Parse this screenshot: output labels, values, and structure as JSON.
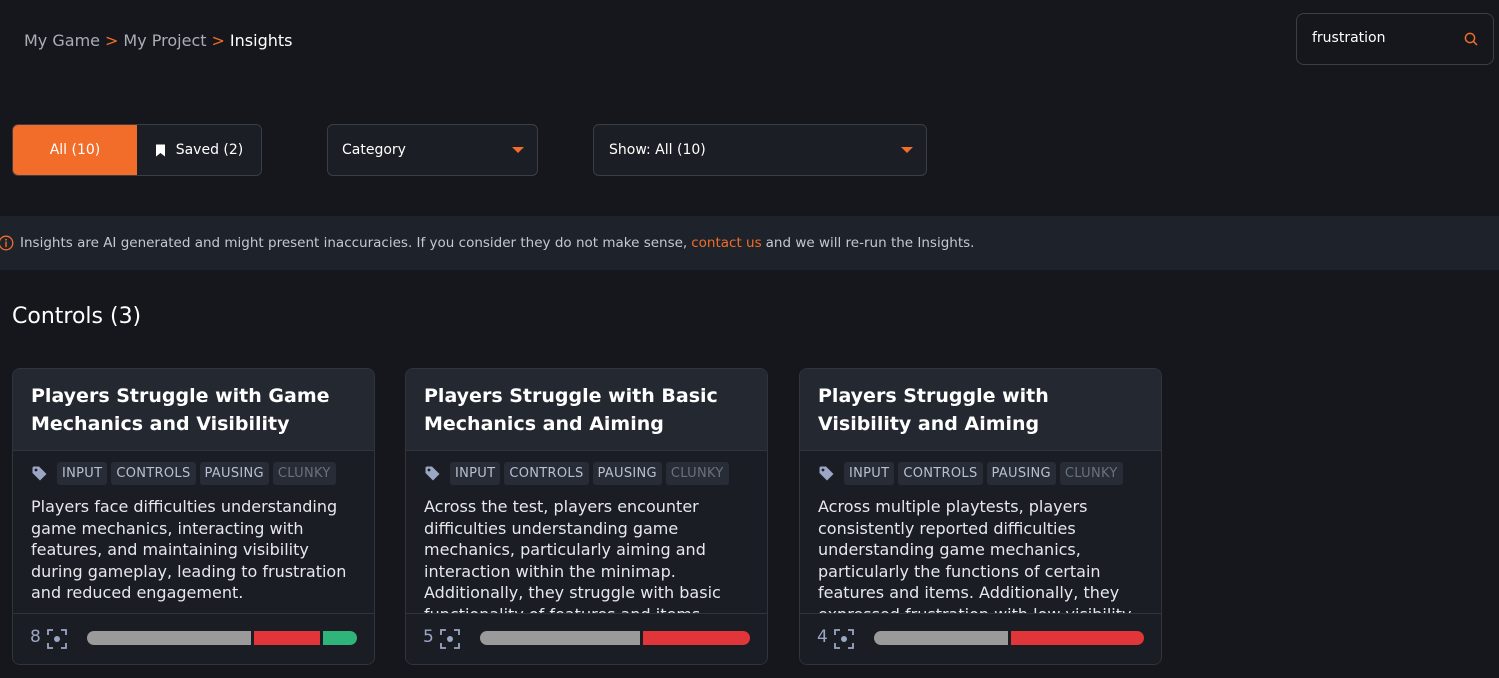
{
  "breadcrumb": {
    "items": [
      "My Game",
      "My Project"
    ],
    "current": "Insights",
    "separator": ">"
  },
  "search": {
    "value": "frustration",
    "placeholder": ""
  },
  "tabs": {
    "all_label": "All (10)",
    "saved_label": "Saved (2)"
  },
  "filters": {
    "category_label": "Category",
    "show_label": "Show: All (10)"
  },
  "notice": {
    "text_before": "Insights are AI generated and might present inaccuracies. If you consider they do not make sense,",
    "link_text": "contact us",
    "text_after": "and we will re-run the Insights."
  },
  "section": {
    "title": "Controls (3)"
  },
  "colors": {
    "accent": "#f26c2a",
    "negative": "#e0363a",
    "neutral": "#9a9a9a",
    "positive": "#2fb47a"
  },
  "cards": [
    {
      "title": "Players Struggle with Game Mechanics and Visibility",
      "tags": [
        "INPUT",
        "CONTROLS",
        "PAUSING",
        "CLUNKY"
      ],
      "body": "Players face difficulties understanding game mechanics, interacting with features, and maintaining visibility during gameplay, leading to frustration and reduced engagement.",
      "count": "8",
      "sentiment": {
        "neutral": 0.62,
        "negative": 0.25,
        "positive": 0.13
      }
    },
    {
      "title": "Players Struggle with Basic Mechanics and Aiming",
      "tags": [
        "INPUT",
        "CONTROLS",
        "PAUSING",
        "CLUNKY"
      ],
      "body": "Across the test, players encounter difficulties understanding game mechanics, particularly aiming and interaction within the minimap. Additionally, they struggle with basic functionality of features and items.",
      "count": "5",
      "sentiment": {
        "neutral": 0.6,
        "negative": 0.4,
        "positive": 0
      }
    },
    {
      "title": "Players Struggle with Visibility and Aiming",
      "tags": [
        "INPUT",
        "CONTROLS",
        "PAUSING",
        "CLUNKY"
      ],
      "body": "Across multiple playtests, players consistently reported difficulties understanding game mechanics, particularly the functions of certain features and items. Additionally, they expressed frustration with low visibility.",
      "count": "4",
      "sentiment": {
        "neutral": 0.5,
        "negative": 0.5,
        "positive": 0
      }
    }
  ]
}
